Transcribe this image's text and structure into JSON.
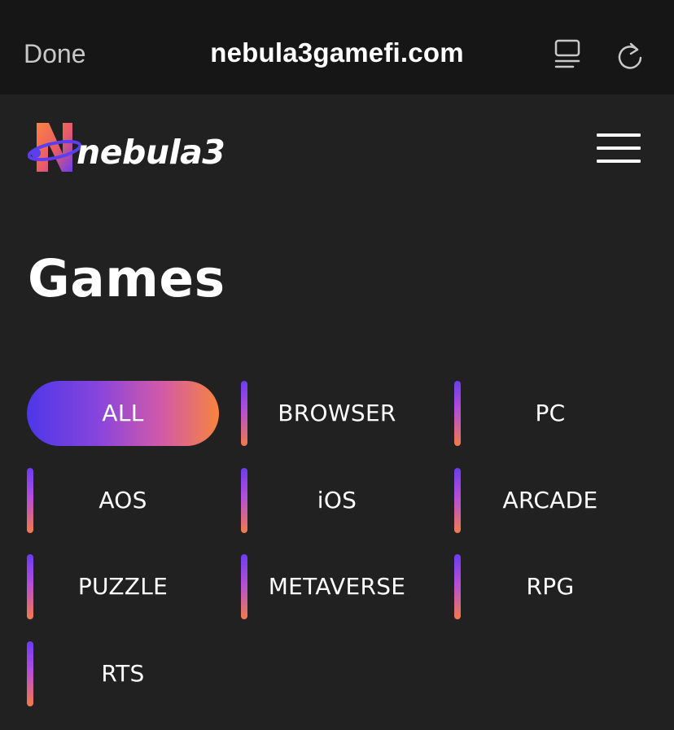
{
  "browser": {
    "done_label": "Done",
    "url": "nebula3gamefi.com",
    "reader_icon": "reader-mode-icon",
    "reload_icon": "reload-icon"
  },
  "header": {
    "logo_text": "nebula3",
    "menu_icon": "hamburger-menu-icon"
  },
  "main": {
    "title": "Games",
    "filters": [
      {
        "label": "ALL",
        "active": true
      },
      {
        "label": "BROWSER",
        "active": false
      },
      {
        "label": "PC",
        "active": false
      },
      {
        "label": "AOS",
        "active": false
      },
      {
        "label": "iOS",
        "active": false
      },
      {
        "label": "ARCADE",
        "active": false
      },
      {
        "label": "PUZZLE",
        "active": false
      },
      {
        "label": "METAVERSE",
        "active": false
      },
      {
        "label": "RPG",
        "active": false
      },
      {
        "label": "RTS",
        "active": false
      }
    ]
  },
  "colors": {
    "background": "#212121",
    "browser_bar": "#161616",
    "gradient_start": "#4d37e8",
    "gradient_end": "#f7843e"
  }
}
